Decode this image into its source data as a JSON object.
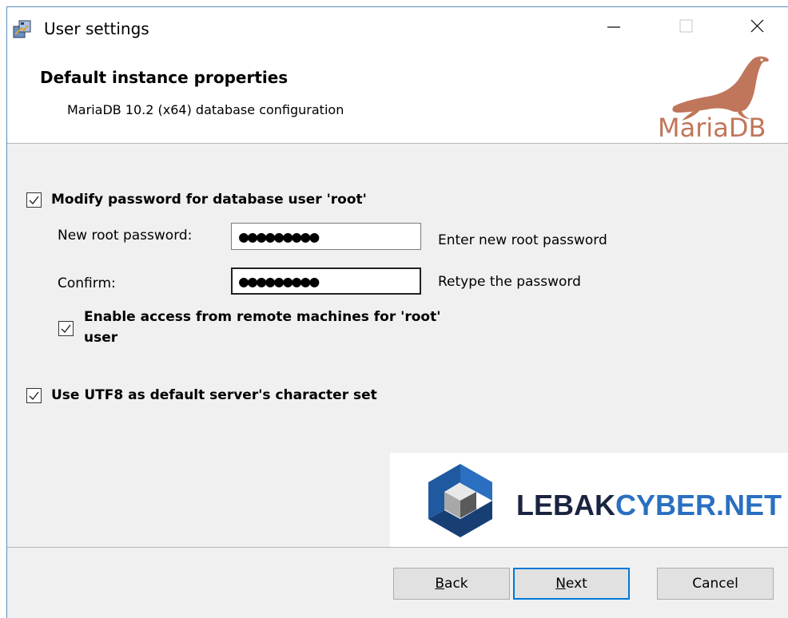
{
  "window": {
    "title": "User settings",
    "icon": "installer-icon"
  },
  "header": {
    "title": "Default instance properties",
    "subtitle": "MariaDB 10.2 (x64) database configuration",
    "logo_text": "MariaDB"
  },
  "form": {
    "modify_password": {
      "label": "Modify password for database user 'root'",
      "checked": true
    },
    "new_password": {
      "label": "New root password:",
      "value": "●●●●●●●●●",
      "hint": "Enter new root password"
    },
    "confirm": {
      "label": "Confirm:",
      "value": "●●●●●●●●●",
      "hint": "Retype the password"
    },
    "remote_access": {
      "label_line1": "Enable access from remote machines for 'root'",
      "label_line2": "user",
      "checked": true
    },
    "utf8": {
      "label": "Use UTF8 as default server's character set",
      "checked": true
    }
  },
  "watermark": {
    "part1": "LEBAK",
    "part2": "CYBER.NET"
  },
  "buttons": {
    "back": {
      "mnemonic": "B",
      "rest": "ack"
    },
    "next": {
      "mnemonic": "N",
      "rest": "ext"
    },
    "cancel": "Cancel"
  },
  "colors": {
    "accent": "#0078d7",
    "watermark_blue": "#2a6fc0",
    "watermark_dark": "#1a2440",
    "mariadb_brown": "#c0765a"
  }
}
